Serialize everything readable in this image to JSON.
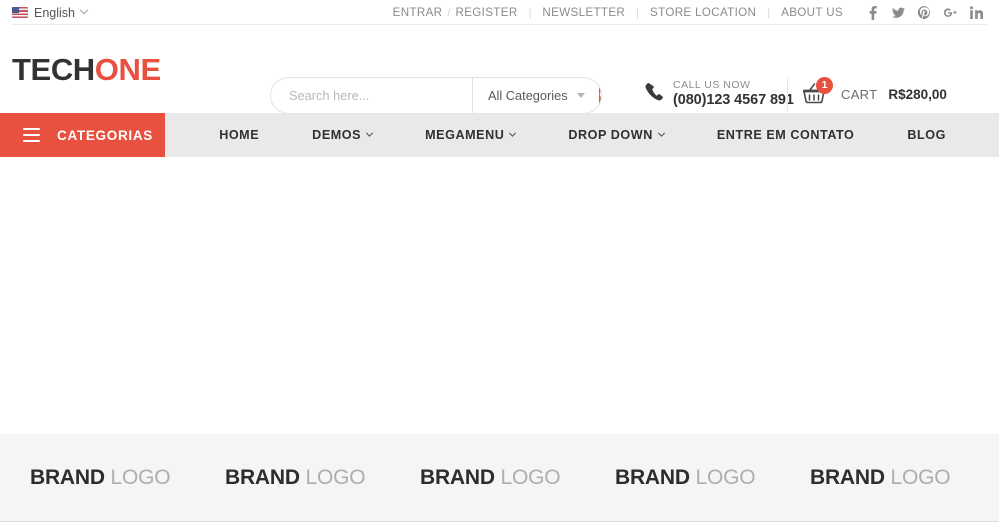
{
  "topbar": {
    "language": {
      "label": "English",
      "icon": "us-flag-icon",
      "chevron": "chevron-down-icon"
    },
    "links": [
      {
        "label": "ENTRAR"
      },
      {
        "label": "REGISTER"
      },
      {
        "label": "NEWSLETTER"
      },
      {
        "label": "STORE LOCATION"
      },
      {
        "label": "ABOUT US"
      }
    ],
    "separator": "|",
    "slash": "/",
    "social": [
      {
        "name": "facebook-icon"
      },
      {
        "name": "twitter-icon"
      },
      {
        "name": "pinterest-icon"
      },
      {
        "name": "google-plus-icon"
      },
      {
        "name": "linkedin-icon"
      }
    ]
  },
  "header": {
    "logo": {
      "part1": "TECH",
      "part2": "ONE"
    },
    "search": {
      "placeholder": "Search here...",
      "value": "",
      "category_selected": "All Categories",
      "button_icon": "search-icon"
    },
    "call": {
      "icon": "phone-icon",
      "label": "CALL US NOW",
      "number": "(080)123 4567 891"
    },
    "cart": {
      "icon": "shopping-basket-icon",
      "count": "1",
      "label": "CART",
      "total": "R$280,00"
    }
  },
  "nav": {
    "categories": {
      "label": "CATEGORIAS",
      "icon": "hamburger-icon"
    },
    "items": [
      {
        "label": "HOME",
        "has_dropdown": false
      },
      {
        "label": "DEMOS",
        "has_dropdown": true
      },
      {
        "label": "MEGAMENU",
        "has_dropdown": true
      },
      {
        "label": "DROP DOWN",
        "has_dropdown": true
      },
      {
        "label": "ENTRE EM CONTATO",
        "has_dropdown": false
      },
      {
        "label": "BLOG",
        "has_dropdown": false
      }
    ]
  },
  "brands": [
    {
      "part1": "BRAND",
      "part2": "LOGO"
    },
    {
      "part1": "BRAND",
      "part2": "LOGO"
    },
    {
      "part1": "BRAND",
      "part2": "LOGO"
    },
    {
      "part1": "BRAND",
      "part2": "LOGO"
    },
    {
      "part1": "BRAND",
      "part2": "LOGO"
    }
  ],
  "colors": {
    "accent_red": "#e8503f",
    "nav_bg": "#e9e9e9",
    "brand_bg": "#f5f5f5",
    "text_dark": "#333333"
  }
}
